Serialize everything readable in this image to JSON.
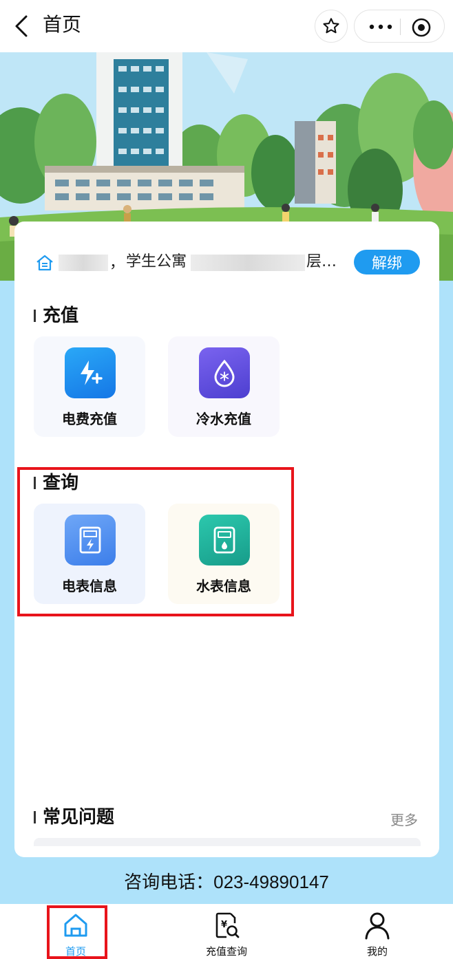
{
  "navbar": {
    "title": "首页",
    "icons": [
      "back-chevron-icon",
      "star-icon",
      "more-dots-icon",
      "close-mini-program-icon"
    ]
  },
  "card": {
    "address": {
      "icon": "home-icon",
      "separator": "，",
      "building": "学生公寓",
      "floor": "层…",
      "unbind_label": "解绑"
    },
    "recharge": {
      "title": "充值",
      "tiles": [
        {
          "label": "电费充值",
          "icon": "electric-recharge-icon",
          "color": "#1a8ff0"
        },
        {
          "label": "冷水充值",
          "icon": "water-drop-icon",
          "color": "#5d4fd8"
        }
      ]
    },
    "query": {
      "title": "查询",
      "tiles": [
        {
          "label": "电表信息",
          "icon": "electric-meter-icon",
          "color": "#4f8ff2"
        },
        {
          "label": "水表信息",
          "icon": "water-meter-icon",
          "color": "#20b59c"
        }
      ]
    },
    "faq": {
      "title": "常见问题",
      "more_label": "更多"
    }
  },
  "hotline": {
    "label": "咨询电话：",
    "number": "023-49890147"
  },
  "tabbar": {
    "tabs": [
      {
        "label": "首页",
        "icon": "home-tab-icon",
        "active": true
      },
      {
        "label": "充值查询",
        "icon": "recharge-query-icon",
        "active": false
      },
      {
        "label": "我的",
        "icon": "user-icon",
        "active": false
      }
    ]
  },
  "colors": {
    "accent": "#1f9bf0",
    "page_background": "#aee2fa",
    "highlight": "#e8141b"
  }
}
